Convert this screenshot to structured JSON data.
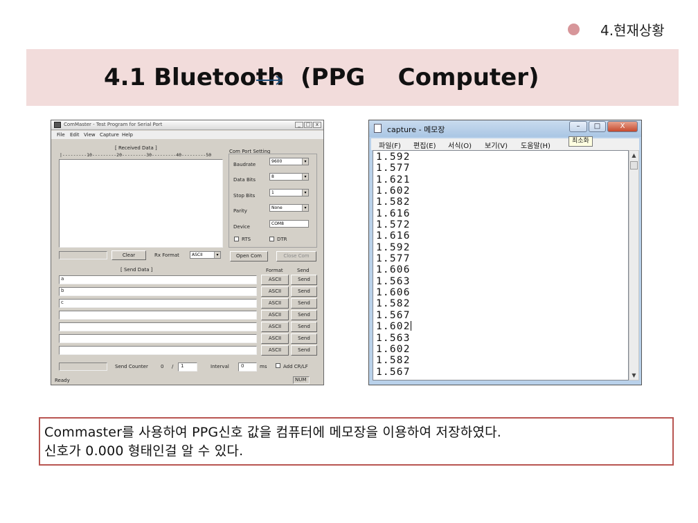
{
  "header": {
    "section_title": "4.현재상황",
    "slide_title": "4.1 Bluetooth  (PPG    Computer)"
  },
  "colors": {
    "accent_dot": "#d7969a",
    "title_band": "#f2dcdb",
    "caption_border": "#b85450",
    "arrow": "#1f4e79"
  },
  "commaster": {
    "title": "ComMaster - Test Program for Serial Port",
    "menu": [
      "File",
      "Edit",
      "View",
      "Capture",
      "Help"
    ],
    "received_label": "[ Received Data ]",
    "ruler": "|---------10---------20---------30---------40---------50",
    "port_group_label": "Com Port Setting",
    "baudrate_label": "Baudrate",
    "baudrate_value": "9600",
    "databits_label": "Data Bits",
    "databits_value": "8",
    "stopbits_label": "Stop Bits",
    "stopbits_value": "1",
    "parity_label": "Parity",
    "parity_value": "None",
    "device_label": "Device",
    "device_value": "COM8",
    "rts_label": "RTS",
    "dtr_label": "DTR",
    "clear_button": "Clear",
    "rx_format_label": "Rx Format",
    "rx_format_value": "ASCII",
    "open_button": "Open Com",
    "close_button": "Close Com",
    "send_label": "[ Send Data ]",
    "format_header": "Format",
    "send_header": "Send",
    "send_rows": [
      {
        "value": "a",
        "format": "ASCII",
        "send": "Send"
      },
      {
        "value": "b",
        "format": "ASCII",
        "send": "Send"
      },
      {
        "value": "c",
        "format": "ASCII",
        "send": "Send"
      },
      {
        "value": "",
        "format": "ASCII",
        "send": "Send"
      },
      {
        "value": "",
        "format": "ASCII",
        "send": "Send"
      },
      {
        "value": "",
        "format": "ASCII",
        "send": "Send"
      },
      {
        "value": "",
        "format": "ASCII",
        "send": "Send"
      }
    ],
    "send_counter_label": "Send Counter",
    "send_counter_value": "0",
    "send_counter_sep": "/",
    "send_counter_total": "1",
    "interval_label": "Interval",
    "interval_value": "0",
    "interval_unit": "ms",
    "add_crlf_label": "Add CR/LF",
    "status_left": "Ready",
    "status_right": "NUM"
  },
  "notepad": {
    "title": "capture - 메모장",
    "minimize": "–",
    "maximize": "□",
    "close": "X",
    "tooltip": "최소화",
    "menu": [
      "파일(F)",
      "편집(E)",
      "서식(O)",
      "보기(V)",
      "도움말(H)"
    ],
    "lines": [
      "1.592",
      "1.577",
      "1.621",
      "1.602",
      "1.582",
      "1.616",
      "1.572",
      "1.616",
      "1.592",
      "1.577",
      "1.606",
      "1.563",
      "1.606",
      "1.582",
      "1.567",
      "1.602",
      "1.563",
      "1.602",
      "1.582",
      "1.567"
    ],
    "caret_line_index": 15
  },
  "caption": {
    "line1": "Commaster를 사용하여 PPG신호 값을 컴퓨터에 메모장을 이용하여 저장하였다.",
    "line2": "신호가 0.000 형태인걸 알 수 있다."
  }
}
